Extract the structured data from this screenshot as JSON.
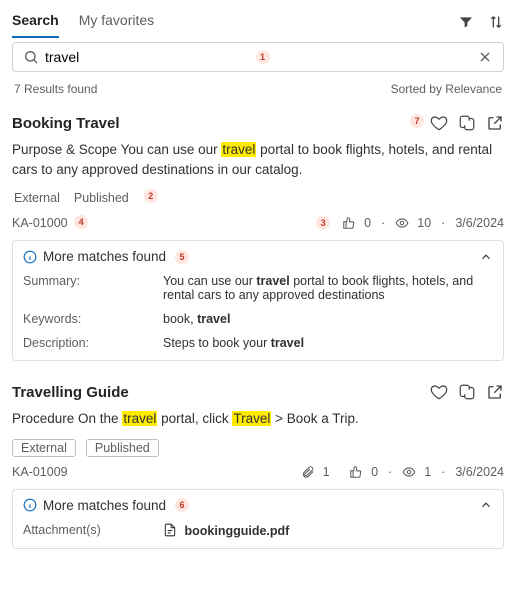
{
  "tabs": {
    "search": "Search",
    "favorites": "My favorites"
  },
  "search": {
    "value": "travel"
  },
  "meta": {
    "results": "7 Results found",
    "sort": "Sorted by Relevance"
  },
  "markers": {
    "m1": "1",
    "m2": "2",
    "m3": "3",
    "m4": "4",
    "m5": "5",
    "m6": "6",
    "m7": "7"
  },
  "r1": {
    "title": "Booking Travel",
    "snippet_a": "Purpose & Scope You can use our ",
    "snippet_hl": "travel",
    "snippet_b": " portal to book flights, hotels, and rental cars to any approved destinations in our catalog.",
    "tag_ext": "External",
    "tag_pub": "Published",
    "id": "KA-01000",
    "likes": "0",
    "views": "10",
    "date": "3/6/2024",
    "more": "More matches found",
    "kv": {
      "summary_k": "Summary:",
      "summary_v1": "You can use our ",
      "summary_vb": "travel",
      "summary_v2": " portal to book flights, hotels, and rental cars to any approved destinations",
      "keywords_k": "Keywords:",
      "keywords_v1": "book, ",
      "keywords_vb": "travel",
      "desc_k": "Description:",
      "desc_v1": "Steps to book your ",
      "desc_vb": "travel"
    }
  },
  "r2": {
    "title": "Travelling Guide",
    "snippet_a": "Procedure On the ",
    "snippet_hl1": "travel",
    "snippet_b": " portal, click ",
    "snippet_hl2": "Travel",
    "snippet_c": " > Book a Trip.",
    "tag_ext": "External",
    "tag_pub": "Published",
    "id": "KA-01009",
    "attach": "1",
    "likes": "0",
    "views": "1",
    "date": "3/6/2024",
    "more": "More matches found",
    "kv": {
      "att_k": "Attachment(s)",
      "att_v": "bookingguide.pdf"
    }
  }
}
